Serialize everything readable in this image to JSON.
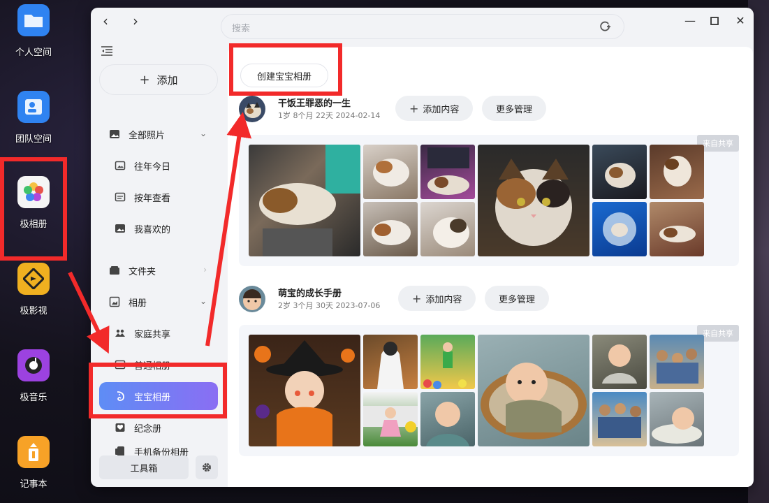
{
  "desktop": {
    "icons": [
      {
        "label": "个人空间",
        "color": "#2f83f1"
      },
      {
        "label": "团队空间",
        "color": "#2f83f1"
      },
      {
        "label": "极相册",
        "color": "#f5f5f5"
      },
      {
        "label": "极影视",
        "color": "#f0b020"
      },
      {
        "label": "极音乐",
        "color": "#9c42e0"
      },
      {
        "label": "记事本",
        "color": "#f7a227"
      }
    ]
  },
  "window": {
    "search": {
      "placeholder": "搜索"
    }
  },
  "sidebar": {
    "add_label": "添加",
    "items": [
      {
        "label": "全部照片",
        "icon": "photo-icon"
      },
      {
        "label": "往年今日",
        "icon": "image-icon"
      },
      {
        "label": "按年查看",
        "icon": "calendar-icon"
      },
      {
        "label": "我喜欢的",
        "icon": "heart-icon"
      },
      {
        "label": "文件夹",
        "icon": "folder-icon"
      },
      {
        "label": "相册",
        "icon": "album-icon"
      },
      {
        "label": "家庭共享",
        "icon": "family-icon"
      },
      {
        "label": "普通相册",
        "icon": "album-icon"
      },
      {
        "label": "宝宝相册",
        "icon": "baby-icon"
      },
      {
        "label": "纪念册",
        "icon": "memorial-icon"
      },
      {
        "label": "手机备份相册",
        "icon": "phone-icon"
      }
    ],
    "toolbox_label": "工具箱"
  },
  "main": {
    "create_label": "创建宝宝相册",
    "albums": [
      {
        "title": "干饭王罪恶的一生",
        "meta": "1岁 8个月 22天  2024-02-14",
        "add_label": "添加内容",
        "manage_label": "更多管理",
        "shared_label": "来自共享"
      },
      {
        "title": "萌宝的成长手册",
        "meta": "2岁 3个月 30天  2023-07-06",
        "add_label": "添加内容",
        "manage_label": "更多管理",
        "shared_label": "来自共享"
      }
    ]
  },
  "colors": {
    "annotation": "#f22a2a",
    "active_start": "#5e8df5",
    "active_end": "#8a6ef3"
  }
}
